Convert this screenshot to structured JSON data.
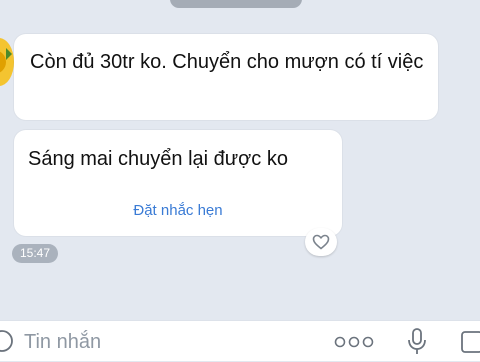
{
  "messages": [
    {
      "text": "Còn đủ 30tr ko. Chuyển cho mượn có tí việc"
    },
    {
      "text": "Sáng mai chuyển lại được ko",
      "action": "Đặt nhắc hẹn"
    }
  ],
  "timestamp": "15:47",
  "input": {
    "placeholder": "Tin nhắn"
  },
  "icons": {
    "avatar": "sunflower-avatar",
    "reaction": "heart-icon",
    "more": "more-icon",
    "mic": "mic-icon",
    "emoji": "emoji-icon",
    "image": "image-icon"
  },
  "colors": {
    "background": "#e3e8f0",
    "bubble": "#ffffff",
    "link": "#3a7bd5",
    "time_pill": "#aab2bd"
  }
}
